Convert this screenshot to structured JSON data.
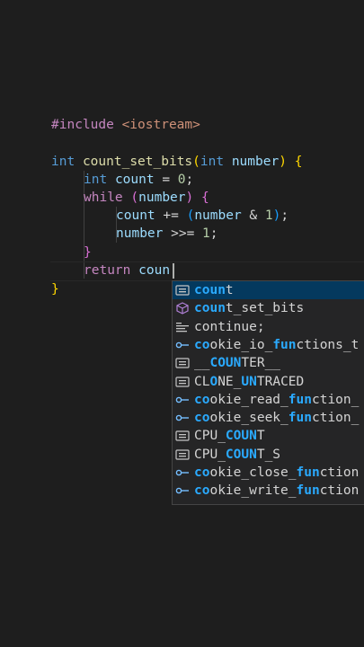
{
  "editor": {
    "lines": {
      "include_kw": "#include",
      "include_file": "<iostream>",
      "fn_type": "int",
      "fn_name": "count_set_bits",
      "param_type": "int",
      "param_name": "number",
      "var_type": "int",
      "var_name": "count",
      "var_eq": " = ",
      "var_val": "0",
      "while_kw": "while",
      "while_var": "number",
      "body1_var": "count",
      "body1_op": " += ",
      "body1_var2": "number",
      "body1_amp": " & ",
      "body1_num": "1",
      "body2_var": "number",
      "body2_op": " >>= ",
      "body2_num": "1",
      "return_kw": "return",
      "return_typed": "coun"
    }
  },
  "suggestions": [
    {
      "icon": "keyword-icon",
      "pre": "",
      "hl1": "coun",
      "mid": "t",
      "hl2": "",
      "post": "",
      "selected": true
    },
    {
      "icon": "cube-icon",
      "pre": "",
      "hl1": "coun",
      "mid": "t_set_bits",
      "hl2": "",
      "post": "",
      "selected": false
    },
    {
      "icon": "snippet-icon",
      "pre": "",
      "hl1": "",
      "mid": "continue;",
      "hl2": "",
      "post": "",
      "selected": false
    },
    {
      "icon": "field-icon",
      "pre": "",
      "hl1": "co",
      "mid": "okie_io_",
      "hl2": "fun",
      "post": "ctions_t",
      "selected": false
    },
    {
      "icon": "text-icon",
      "pre": "__",
      "hl1": "COUN",
      "mid": "TER__",
      "hl2": "",
      "post": "",
      "selected": false
    },
    {
      "icon": "text-icon",
      "pre": "CL",
      "hl1": "O",
      "mid": "NE_",
      "hl2": "UN",
      "post": "TRACED",
      "selected": false
    },
    {
      "icon": "field-icon",
      "pre": "",
      "hl1": "co",
      "mid": "okie_read_",
      "hl2": "fun",
      "post": "ction_",
      "selected": false
    },
    {
      "icon": "field-icon",
      "pre": "",
      "hl1": "co",
      "mid": "okie_seek_",
      "hl2": "fun",
      "post": "ction_",
      "selected": false
    },
    {
      "icon": "text-icon",
      "pre": "CPU_",
      "hl1": "COUN",
      "mid": "T",
      "hl2": "",
      "post": "",
      "selected": false
    },
    {
      "icon": "text-icon",
      "pre": "CPU_",
      "hl1": "COUN",
      "mid": "T_S",
      "hl2": "",
      "post": "",
      "selected": false
    },
    {
      "icon": "field-icon",
      "pre": "",
      "hl1": "co",
      "mid": "okie_close_",
      "hl2": "fun",
      "post": "ction",
      "selected": false
    },
    {
      "icon": "field-icon",
      "pre": "",
      "hl1": "co",
      "mid": "okie_write_",
      "hl2": "fun",
      "post": "ction",
      "selected": false
    }
  ],
  "colors": {
    "background": "#1e1e1e",
    "suggest_bg": "#252526",
    "selected_bg": "#04395e",
    "highlight": "#2aaaff"
  }
}
